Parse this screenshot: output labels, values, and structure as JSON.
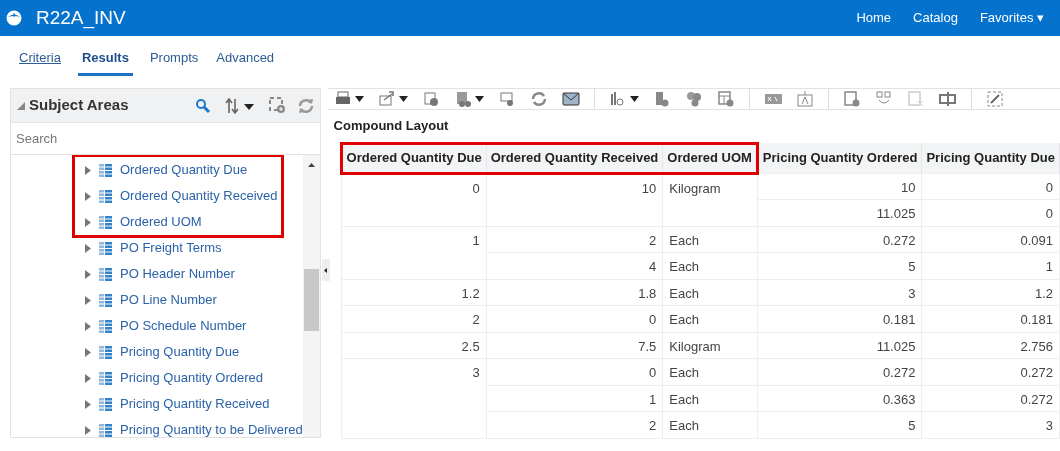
{
  "app_bar": {
    "title": "R22A_INV",
    "links": [
      "Home",
      "Catalog",
      "Favorites"
    ],
    "menu_caret": "▾"
  },
  "tabs": [
    {
      "label": "Criteria",
      "selected": false,
      "kind": "link"
    },
    {
      "label": "Results",
      "selected": true,
      "kind": "tab"
    },
    {
      "label": "Prompts",
      "selected": false,
      "kind": "tab"
    },
    {
      "label": "Advanced",
      "selected": false,
      "kind": "tab"
    }
  ],
  "subject_areas": {
    "title": "Subject Areas",
    "search": {
      "placeholder": "Search"
    },
    "items": [
      {
        "label": "Ordered Quantity Due",
        "highlighted": true
      },
      {
        "label": "Ordered Quantity Received",
        "highlighted": true
      },
      {
        "label": "Ordered UOM",
        "highlighted": true
      },
      {
        "label": "PO Freight Terms",
        "highlighted": false
      },
      {
        "label": "PO Header Number",
        "highlighted": false
      },
      {
        "label": "PO Line Number",
        "highlighted": false
      },
      {
        "label": "PO Schedule Number",
        "highlighted": false
      },
      {
        "label": "Pricing Quantity Due",
        "highlighted": false
      },
      {
        "label": "Pricing Quantity Ordered",
        "highlighted": false
      },
      {
        "label": "Pricing Quantity Received",
        "highlighted": false
      },
      {
        "label": "Pricing Quantity to be Delivered",
        "highlighted": false
      }
    ]
  },
  "layout_title": "Compound Layout",
  "table": {
    "columns": [
      {
        "label": "Ordered Quantity Due",
        "highlighted": true
      },
      {
        "label": "Ordered Quantity Received",
        "highlighted": true
      },
      {
        "label": "Ordered UOM",
        "highlighted": true
      },
      {
        "label": "Pricing Quantity Ordered",
        "highlighted": false
      },
      {
        "label": "Pricing Quantity Due",
        "highlighted": false
      }
    ],
    "groups": [
      {
        "due": "0",
        "items": [
          {
            "received": "10",
            "uom": "Kilogram",
            "pricing": [
              [
                "10",
                "0"
              ],
              [
                "11.025",
                "0"
              ]
            ]
          }
        ]
      },
      {
        "due": "1",
        "items": [
          {
            "received": "2",
            "uom": "Each",
            "pricing": [
              [
                "0.272",
                "0.091"
              ]
            ]
          },
          {
            "received": "4",
            "uom": "Each",
            "pricing": [
              [
                "5",
                "1"
              ]
            ]
          }
        ]
      },
      {
        "due": "1.2",
        "items": [
          {
            "received": "1.8",
            "uom": "Each",
            "pricing": [
              [
                "3",
                "1.2"
              ]
            ]
          }
        ]
      },
      {
        "due": "2",
        "items": [
          {
            "received": "0",
            "uom": "Each",
            "pricing": [
              [
                "0.181",
                "0.181"
              ]
            ]
          }
        ]
      },
      {
        "due": "2.5",
        "items": [
          {
            "received": "7.5",
            "uom": "Kilogram",
            "pricing": [
              [
                "11.025",
                "2.756"
              ]
            ]
          }
        ]
      },
      {
        "due": "3",
        "items": [
          {
            "received": "0",
            "uom": "Each",
            "pricing": [
              [
                "0.272",
                "0.272"
              ]
            ]
          },
          {
            "received": "1",
            "uom": "Each",
            "pricing": [
              [
                "0.363",
                "0.272"
              ]
            ]
          },
          {
            "received": "2",
            "uom": "Each",
            "pricing": [
              [
                "5",
                "3"
              ]
            ]
          }
        ]
      }
    ]
  }
}
